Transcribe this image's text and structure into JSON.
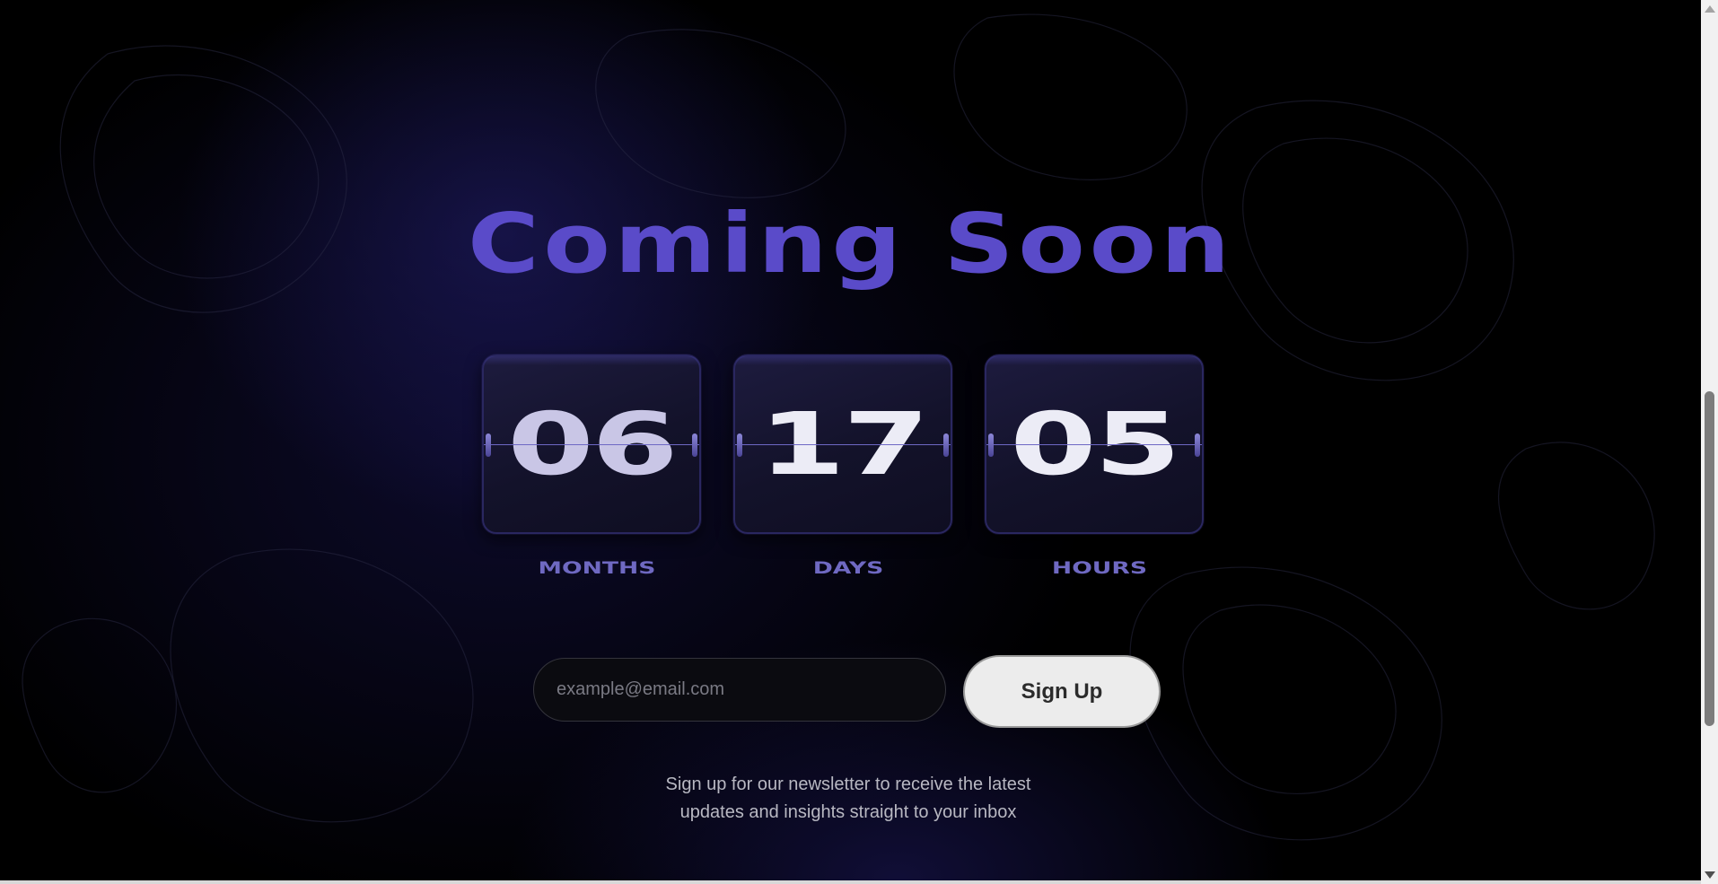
{
  "page": {
    "title": "Coming Soon"
  },
  "countdown": [
    {
      "value": "06",
      "label": "MONTHS"
    },
    {
      "value": "17",
      "label": "DAYS"
    },
    {
      "value": "05",
      "label": "HOURS"
    }
  ],
  "signup_form": {
    "email_placeholder": "example@email.com",
    "email_value": "",
    "button_label": "Sign Up"
  },
  "newsletter_note": {
    "line1": "Sign up for our newsletter to receive the latest",
    "line2": "updates and insights straight to your inbox"
  },
  "colors": {
    "title": "#5a4bc9",
    "label": "#6f69c2",
    "background": "#000000",
    "button_bg": "#ececec"
  }
}
